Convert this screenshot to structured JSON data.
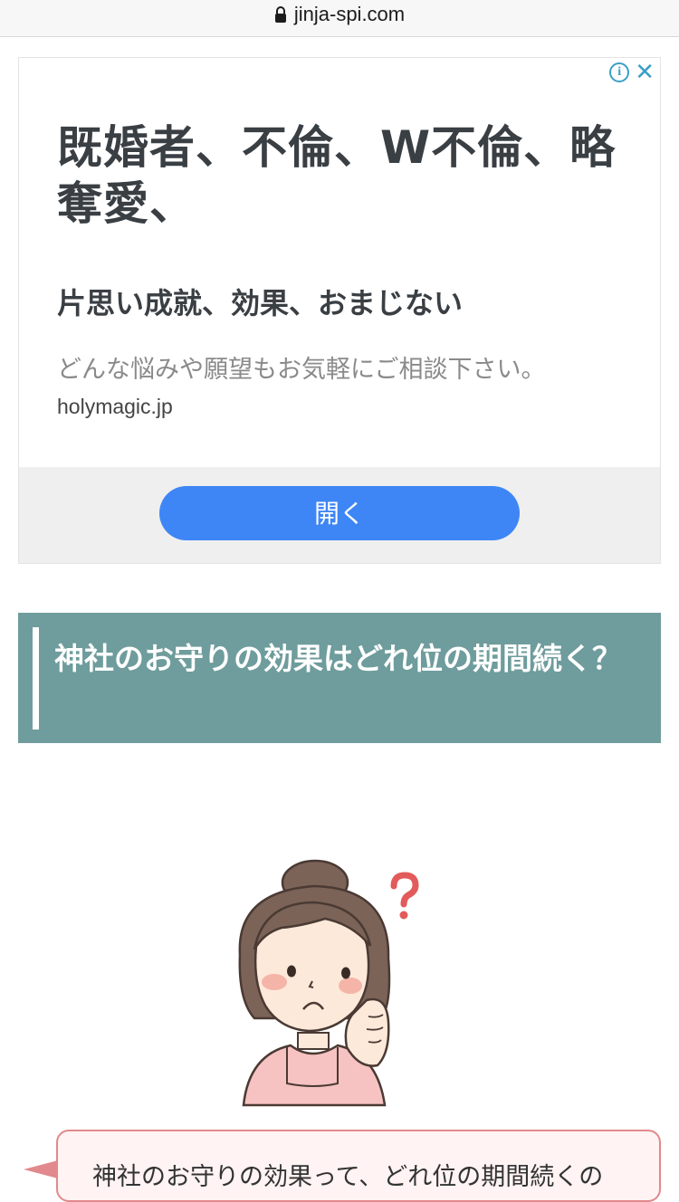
{
  "browser": {
    "url": "jinja-spi.com"
  },
  "ad": {
    "info_icon": "i",
    "close_icon": "✕",
    "headline": "既婚者、不倫、W不倫、略奪愛、",
    "subheadline": "片思い成就、効果、おまじない",
    "description": "どんな悩みや願望もお気軽にご相談下さい。",
    "domain": "holymagic.jp",
    "open_button": "開く",
    "accent_color": "#3e86f5"
  },
  "article": {
    "heading": "神社のお守りの効果はどれ位の期間続く？",
    "heading_bg": "#6f9c9c",
    "bubble_text": "神社のお守りの効果って、どれ位の期間続くの"
  },
  "icons": [
    "lock-icon",
    "info-icon",
    "close-icon",
    "question-mark-icon"
  ]
}
